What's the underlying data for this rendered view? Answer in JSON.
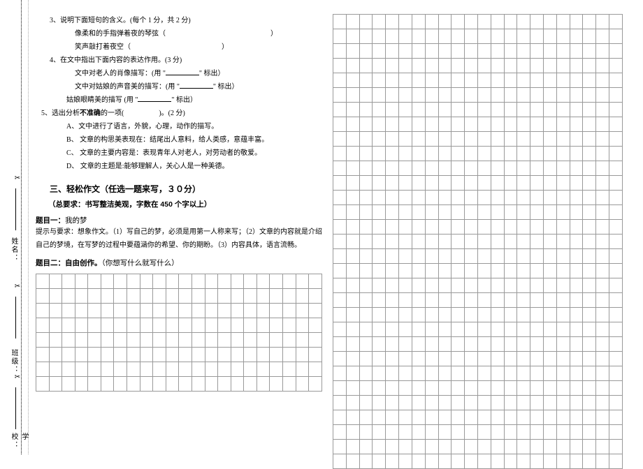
{
  "margin": {
    "school": "学校：",
    "class": "班级：",
    "name": "姓名：",
    "cut": "✂"
  },
  "q3": {
    "head": "3、说明下面短句的含义。(每个 1 分，共 2 分)",
    "line1_a": "像柔和的手指弹着夜的琴弦（",
    "line1_b": "）",
    "line2_a": "笑声敲打着夜空（",
    "line2_b": "）"
  },
  "q4": {
    "head": "4、在文中指出下面内容的表达作用。(3 分)",
    "line1_a": "文中对老人的肖像描写：(用 \"",
    "line1_b": "\" 标出）",
    "line2_a": "文中对姑娘的声音美的描写：(用 \"",
    "line2_b": "\" 标出）",
    "line3_a": "姑娘眼睛美的描写 (用 \"",
    "line3_b": "\" 标出）"
  },
  "q5": {
    "head_a": "5、选出分析",
    "head_bold": "不准确",
    "head_b": "的一项(",
    "head_c": ")。(2 分)",
    "optA": "A、文中进行了语言，外貌，心理，动作的描写。",
    "optB": "B、 文章的构思美表现在：结尾出人意料，给人类感，意蕴丰富。",
    "optC": "C、 文章的主要内容是：表现青年人对老人，对劳动者的敬爱。",
    "optD": "D、 文章的主题是:能够理解人，关心人是一种美德。"
  },
  "section3": {
    "title": "三、轻松作文（任选一题来写，３０分）",
    "sub": "（总要求：书写整洁美观，字数在 450 个字以上）"
  },
  "topic1": {
    "label": "题目一：",
    "text": "我的梦",
    "req_full": "提示与要求：想象作文。（1）写自己的梦，必须是用第一人称来写；（2）文章的内容就是介绍自己的梦境，在写梦的过程中要蕴涵你的希望、你的期盼。（3）内容具体，语言流畅。"
  },
  "topic2": {
    "label": "题目二：自由创作。",
    "text": "（你想写什么就写什么）"
  },
  "grid": {
    "left_rows": 8,
    "left_cols": 22,
    "right_rows": 31,
    "right_cols": 22
  }
}
